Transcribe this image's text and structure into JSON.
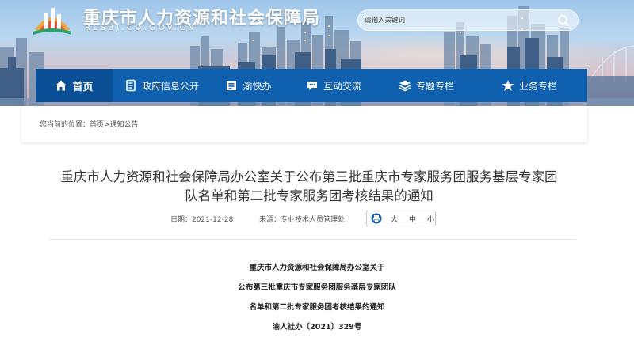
{
  "header": {
    "site_title": "重庆市人力资源和社会保障局",
    "site_domain": "RLSBJ.CQ.GOV.CN",
    "search_placeholder": "请输入关键词"
  },
  "nav": {
    "items": [
      {
        "label": "首页",
        "icon": "home-icon",
        "active": true
      },
      {
        "label": "政府信息公开",
        "icon": "document-icon"
      },
      {
        "label": "渝快办",
        "icon": "briefcase-icon"
      },
      {
        "label": "互动交流",
        "icon": "chat-icon"
      },
      {
        "label": "专题专栏",
        "icon": "layers-icon"
      },
      {
        "label": "业务专栏",
        "icon": "star-icon"
      }
    ]
  },
  "breadcrumb": {
    "prefix": "您当前的位置：",
    "home": "首页",
    "separator": ">",
    "current": "通知公告"
  },
  "article": {
    "title_line1": "重庆市人力资源和社会保障局办公室关于公布第三批重庆市专家服务团服务基层专家团",
    "title_line2": "队名单和第二批专家服务团考核结果的通知",
    "date": "日期：2021-12-28",
    "source": "来源：专业技术人员管理处",
    "font_sizes": [
      "大",
      "中",
      "小"
    ],
    "body_lines": [
      "重庆市人力资源和社会保障局办公室关于",
      "公布第三批重庆市专家服务团服务基层专家团队",
      "名单和第二批专家服务团考核结果的通知",
      "渝人社办〔2021〕329号"
    ]
  },
  "colors": {
    "nav_bg": "#1060b0",
    "nav_active_bg": "#0b4f97",
    "title_text": "#333333"
  }
}
